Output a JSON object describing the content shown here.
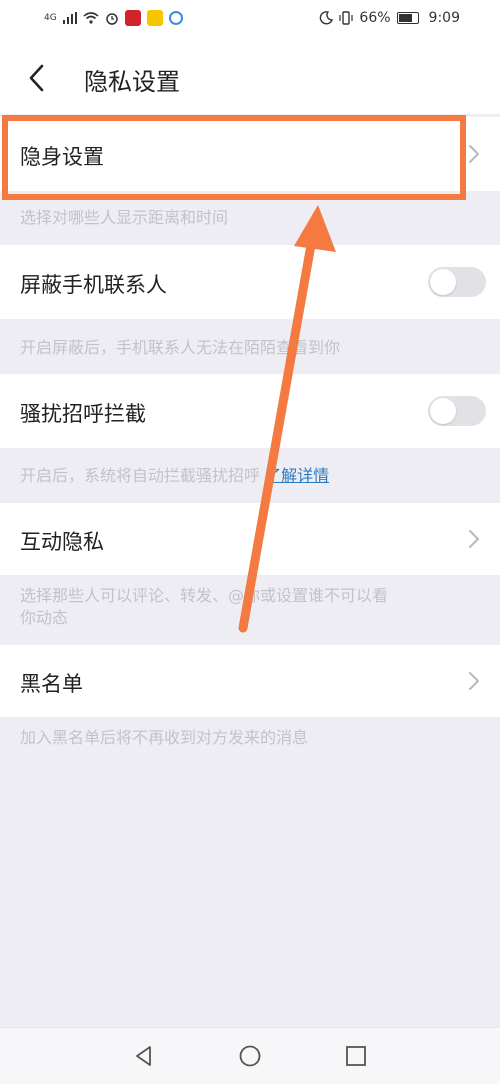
{
  "status_bar": {
    "network": "4G",
    "battery_percent": "66%",
    "time": "9:09",
    "icons": [
      "signal-icon",
      "wifi-icon",
      "alarm-icon",
      "moon-icon",
      "vibrate-icon",
      "battery-icon"
    ]
  },
  "header": {
    "title": "隐私设置",
    "back_icon": "chevron-left-icon"
  },
  "items": [
    {
      "label": "隐身设置",
      "control": "chevron",
      "desc": "选择对哪些人显示距离和时间"
    },
    {
      "label": "屏蔽手机联系人",
      "control": "toggle",
      "toggle_on": false,
      "desc": "开启屏蔽后，手机联系人无法在陌陌查看到你"
    },
    {
      "label": "骚扰招呼拦截",
      "control": "toggle",
      "toggle_on": false,
      "desc": "开启后，系统将自动拦截骚扰招呼",
      "desc_link": "了解详情"
    },
    {
      "label": "互动隐私",
      "control": "chevron",
      "desc_line1": "选择那些人可以评论、转发、@你或设置谁不可以看",
      "desc_line2": "你动态"
    },
    {
      "label": "黑名单",
      "control": "chevron",
      "desc": "加入黑名单后将不再收到对方发来的消息"
    }
  ],
  "annotation": {
    "color": "#f47a42"
  },
  "colors": {
    "background": "#eeedf3",
    "toggle_off": "#e2e2e6",
    "link": "#2a7bc6",
    "accent": "#f47a42"
  }
}
